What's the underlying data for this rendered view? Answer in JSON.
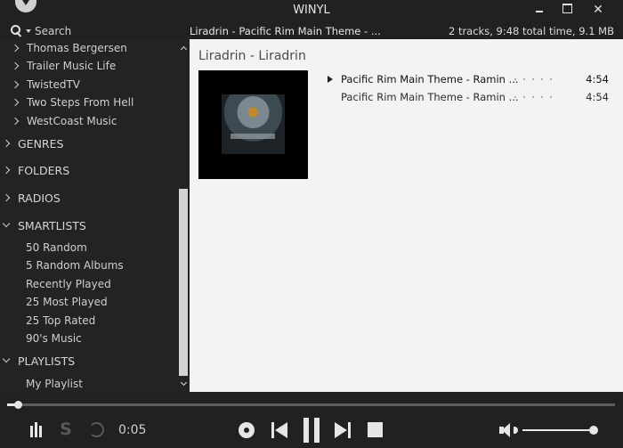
{
  "window": {
    "title": "WINYL",
    "controls": [
      "minimize",
      "maximize",
      "close"
    ]
  },
  "header": {
    "search_label": "Search",
    "now_playing": "Liradrin - Pacific Rim Main Theme - ...",
    "summary": "2 tracks, 9:48 total time, 9.1 MB"
  },
  "sidebar": {
    "artists": [
      {
        "label": "Thomas Bergersen"
      },
      {
        "label": "Trailer Music Life"
      },
      {
        "label": "TwistedTV"
      },
      {
        "label": "Two Steps From Hell"
      },
      {
        "label": "WestCoast Music"
      }
    ],
    "sections": {
      "genres": "GENRES",
      "folders": "FOLDERS",
      "radios": "RADIOS",
      "smartlists": "SMARTLISTS",
      "playlists": "PLAYLISTS"
    },
    "smartlists": [
      {
        "label": "50 Random"
      },
      {
        "label": "5 Random Albums"
      },
      {
        "label": "Recently Played"
      },
      {
        "label": "25 Most Played"
      },
      {
        "label": "25 Top Rated"
      },
      {
        "label": "90's Music"
      }
    ],
    "playlists": [
      {
        "label": "My Playlist"
      }
    ]
  },
  "main": {
    "album_header": "Liradrin - Liradrin",
    "tracks": [
      {
        "title": "Pacific Rim Main Theme - Ramin ...",
        "duration": "4:54",
        "rating": 0,
        "playing": true
      },
      {
        "title": "Pacific Rim Main Theme - Ramin ...",
        "duration": "4:54",
        "rating": 0,
        "playing": false
      }
    ]
  },
  "player": {
    "elapsed": "0:05",
    "progress_fraction": 0.017,
    "volume_fraction": 1.0,
    "shuffle_enabled": false,
    "repeat_enabled": false
  }
}
